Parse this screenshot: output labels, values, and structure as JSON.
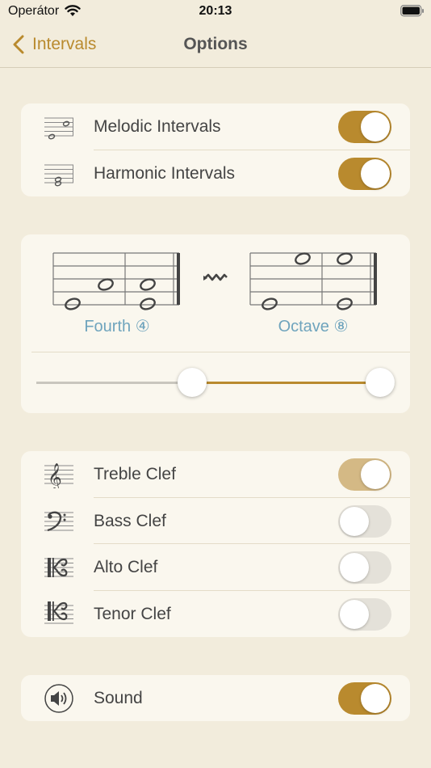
{
  "status_bar": {
    "carrier": "Operátor",
    "time": "20:13"
  },
  "nav": {
    "back_label": "Intervals",
    "title": "Options"
  },
  "interval_types": [
    {
      "label": "Melodic Intervals",
      "icon": "melodic-staff-icon",
      "enabled": true
    },
    {
      "label": "Harmonic Intervals",
      "icon": "harmonic-staff-icon",
      "enabled": true
    }
  ],
  "range": {
    "min_label": "Fourth ④",
    "max_label": "Octave ⑧",
    "min_position": 0.43,
    "max_position": 1.0,
    "range_icon": "range-arrow-icon"
  },
  "clefs": [
    {
      "label": "Treble Clef",
      "icon": "treble-clef-icon",
      "enabled": true
    },
    {
      "label": "Bass Clef",
      "icon": "bass-clef-icon",
      "enabled": false
    },
    {
      "label": "Alto Clef",
      "icon": "alto-clef-icon",
      "enabled": false
    },
    {
      "label": "Tenor Clef",
      "icon": "tenor-clef-icon",
      "enabled": false
    }
  ],
  "sound": {
    "label": "Sound",
    "icon": "speaker-icon",
    "enabled": true
  },
  "colors": {
    "accent": "#b98a2e",
    "accent_light": "#d4b985",
    "interval_label": "#6fa4bd",
    "background": "#f2ecdc",
    "card": "#faf7ee"
  }
}
